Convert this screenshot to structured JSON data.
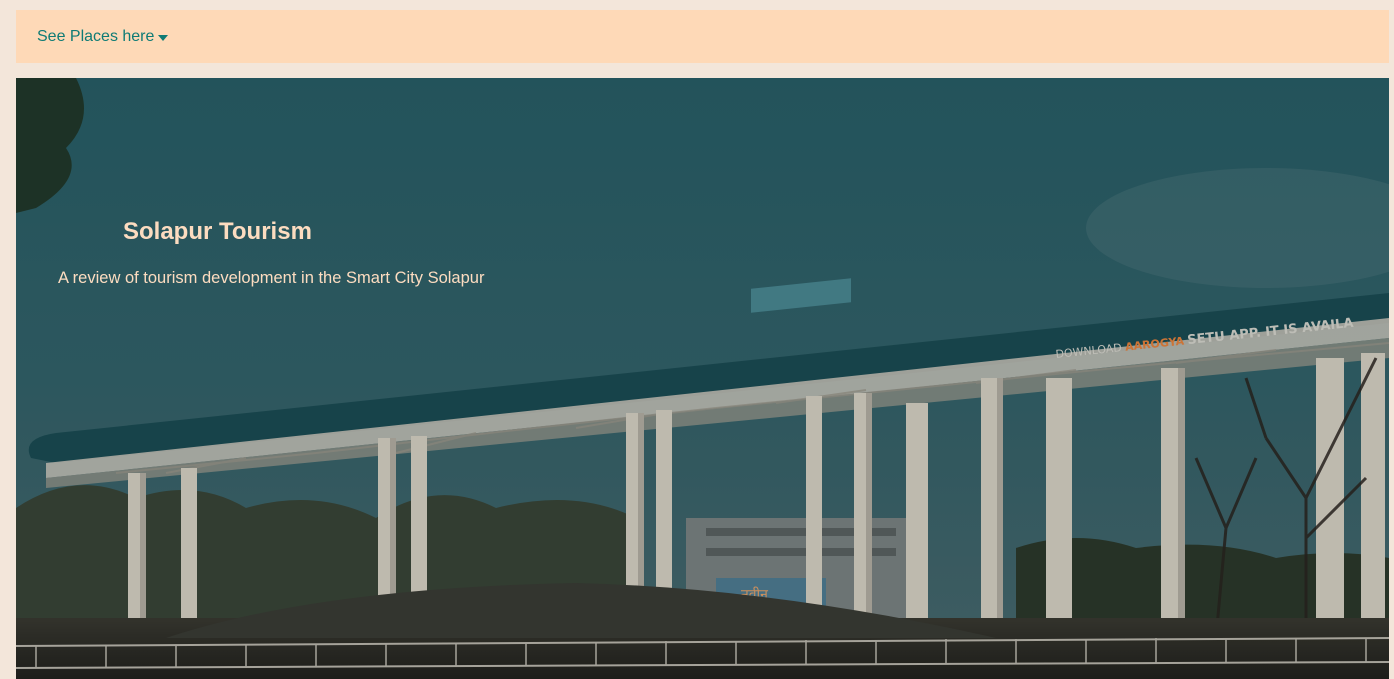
{
  "nav": {
    "dropdown_label": "See Places here"
  },
  "hero": {
    "title": "Solapur Tourism",
    "subtitle": "A review of tourism development in the Smart City Solapur",
    "billboard_prefix": "DOWNLOAD",
    "billboard_brand": "AAROGYA",
    "billboard_suffix": "SETU APP. IT IS AVAILA",
    "sign_text": "नवीन"
  },
  "colors": {
    "topbar_bg": "#fed9b7",
    "link": "#0f7b75",
    "hero_text": "#fcdcc0",
    "sky": "#2a5a62"
  }
}
